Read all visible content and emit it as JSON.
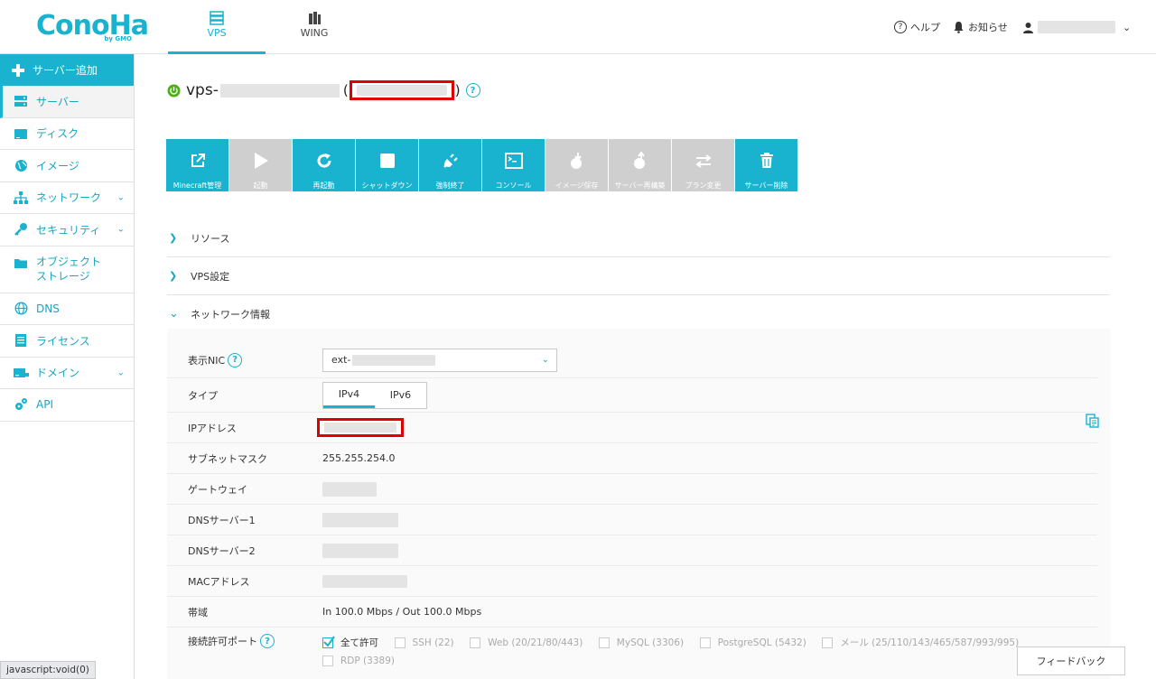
{
  "colors": {
    "brand": "#19b2cf",
    "disabled": "#cfcfcf",
    "highlight": "#e10000",
    "power": "#4caf17"
  },
  "header": {
    "logo_text": "ConoHa",
    "logo_sub": "by GMO",
    "nav": [
      {
        "label": "VPS",
        "icon": "server-stack-icon",
        "active": true
      },
      {
        "label": "WING",
        "icon": "building-icon",
        "active": false
      }
    ],
    "help_label": "ヘルプ",
    "news_label": "お知らせ"
  },
  "sidebar": {
    "add_label": "サーバー追加",
    "items": [
      {
        "label": "サーバー",
        "icon": "server-icon"
      },
      {
        "label": "ディスク",
        "icon": "disk-icon"
      },
      {
        "label": "イメージ",
        "icon": "globe-icon"
      },
      {
        "label": "ネットワーク",
        "icon": "network-icon"
      },
      {
        "label": "セキュリティ",
        "icon": "key-icon"
      },
      {
        "label": "オブジェクト\nストレージ",
        "icon": "folder-icon"
      },
      {
        "label": "DNS",
        "icon": "dns-globe-icon"
      },
      {
        "label": "ライセンス",
        "icon": "license-icon"
      },
      {
        "label": "ドメイン",
        "icon": "domain-icon"
      },
      {
        "label": "API",
        "icon": "gears-icon"
      }
    ]
  },
  "server": {
    "name_prefix": "vps-",
    "paren_open": "(",
    "paren_close": ")"
  },
  "toolbar": [
    {
      "label": "Minecraft管理",
      "icon": "external-link-icon",
      "enabled": true
    },
    {
      "label": "起動",
      "icon": "play-icon",
      "enabled": false
    },
    {
      "label": "再起動",
      "icon": "restart-icon",
      "enabled": true
    },
    {
      "label": "シャットダウン",
      "icon": "stop-icon",
      "enabled": true
    },
    {
      "label": "強制終了",
      "icon": "plug-icon",
      "enabled": true
    },
    {
      "label": "コンソール",
      "icon": "console-icon",
      "enabled": true
    },
    {
      "label": "イメージ保存",
      "icon": "image-save-icon",
      "enabled": false
    },
    {
      "label": "サーバー再構築",
      "icon": "rebuild-icon",
      "enabled": false
    },
    {
      "label": "プラン変更",
      "icon": "swap-icon",
      "enabled": false
    },
    {
      "label": "サーバー削除",
      "icon": "trash-icon",
      "enabled": true
    }
  ],
  "sections": [
    {
      "label": "リソース",
      "expanded": false
    },
    {
      "label": "VPS設定",
      "expanded": false
    },
    {
      "label": "ネットワーク情報",
      "expanded": true
    }
  ],
  "network": {
    "nic_label": "表示NIC",
    "nic_value": "ext-",
    "type_label": "タイプ",
    "type_tabs": [
      "IPv4",
      "IPv6"
    ],
    "ip_label": "IPアドレス",
    "subnet_label": "サブネットマスク",
    "subnet_value": "255.255.254.0",
    "gateway_label": "ゲートウェイ",
    "dns1_label": "DNSサーバー1",
    "dns2_label": "DNSサーバー2",
    "mac_label": "MACアドレス",
    "bandwidth_label": "帯域",
    "bandwidth_value": "In 100.0 Mbps / Out 100.0 Mbps",
    "ports_label": "接続許可ポート",
    "ports": [
      {
        "label": "全て許可",
        "checked": true
      },
      {
        "label": "SSH (22)",
        "checked": false
      },
      {
        "label": "Web (20/21/80/443)",
        "checked": false
      },
      {
        "label": "MySQL (3306)",
        "checked": false
      },
      {
        "label": "PostgreSQL (5432)",
        "checked": false
      },
      {
        "label": "メール (25/110/143/465/587/993/995)",
        "checked": false
      },
      {
        "label": "RDP (3389)",
        "checked": false
      }
    ]
  },
  "feedback_label": "フィードバック",
  "status_bar": "javascript:void(0)"
}
